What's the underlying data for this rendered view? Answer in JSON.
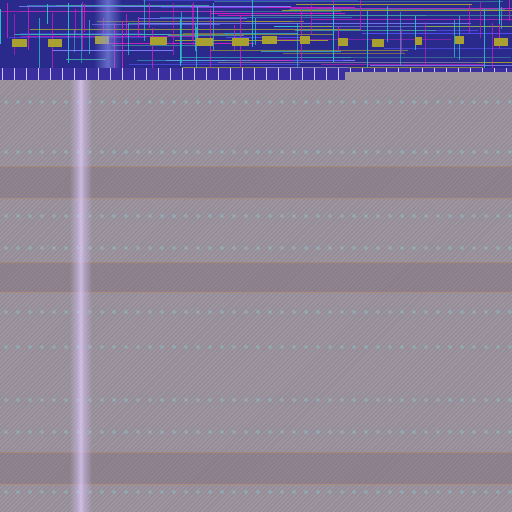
{
  "colors": {
    "background": "#9c939e",
    "top_region": "#2a2a8c",
    "accent_magenta": "#d020c0",
    "accent_olive": "#a8a030",
    "accent_cyan": "#30c0c8",
    "accent_blue": "#5050f0",
    "stripe_line": "#b08a70",
    "glow": "#e0cdfa"
  },
  "regions": [
    {
      "name": "dense-top-band",
      "kind": "glitch-texture"
    },
    {
      "name": "striped-body",
      "kind": "hatched-texture"
    }
  ]
}
